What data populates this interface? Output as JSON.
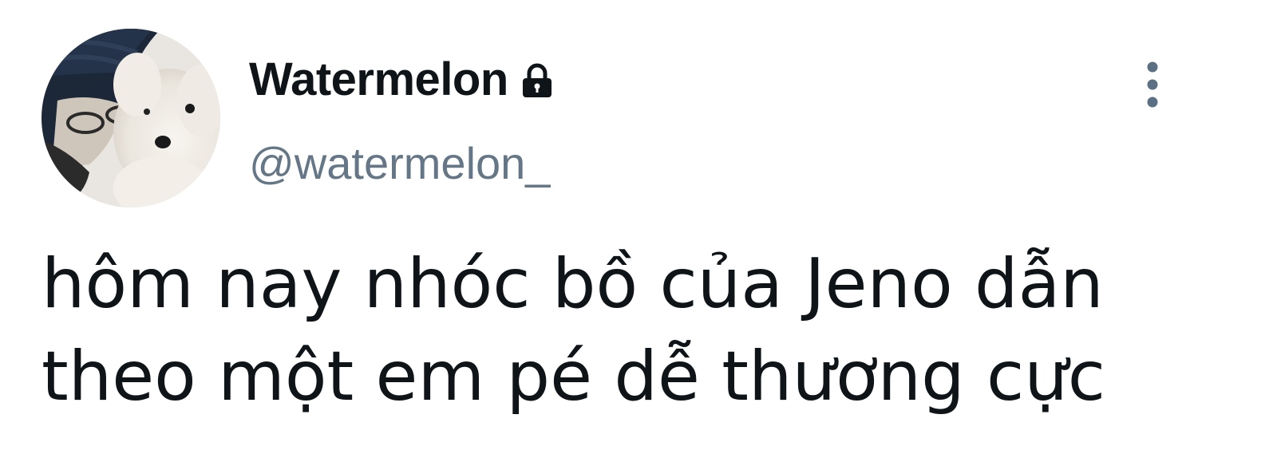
{
  "tweet": {
    "user": {
      "display_name": "Watermelon",
      "handle": "@watermelon_",
      "protected_icon": "lock-icon",
      "avatar_icon": "avatar-photo"
    },
    "menu_icon": "more-vertical-icon",
    "text_lines": [
      "hôm nay nhóc bồ của Jeno dẫn",
      "theo một em pé dễ thương cực"
    ]
  },
  "colors": {
    "text_primary": "#0f1419",
    "text_secondary": "#657786",
    "menu_dots": "#5b7083",
    "background": "#ffffff"
  }
}
